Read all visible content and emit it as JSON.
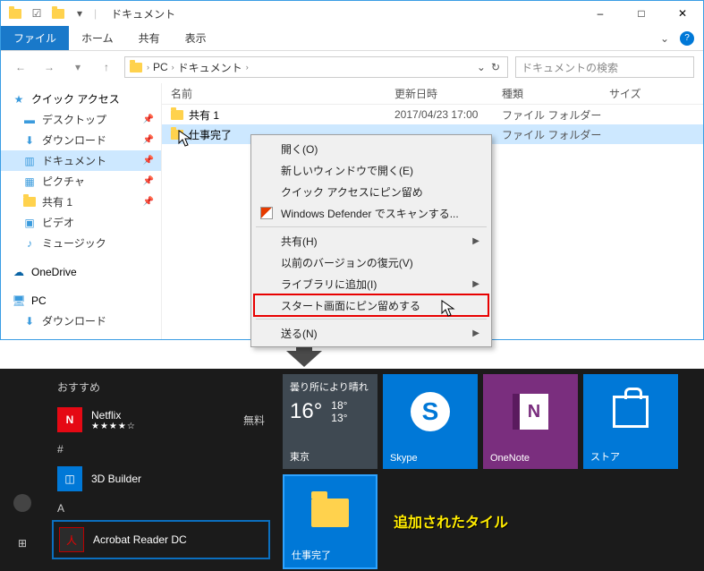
{
  "window": {
    "title": "ドキュメント",
    "controls": {
      "minimize": "–",
      "maximize": "□",
      "close": "✕"
    }
  },
  "ribbon": {
    "file": "ファイル",
    "home": "ホーム",
    "share": "共有",
    "view": "表示",
    "expand": "⌄"
  },
  "address": {
    "pc": "PC",
    "folder": "ドキュメント",
    "refresh": "↻"
  },
  "search": {
    "placeholder": "ドキュメントの検索"
  },
  "nav": {
    "quick_access": "クイック アクセス",
    "desktop": "デスクトップ",
    "downloads": "ダウンロード",
    "documents": "ドキュメント",
    "pictures": "ピクチャ",
    "share1": "共有 1",
    "videos": "ビデオ",
    "music": "ミュージック",
    "onedrive": "OneDrive",
    "pc": "PC",
    "downloads2": "ダウンロード"
  },
  "columns": {
    "name": "名前",
    "date": "更新日時",
    "type": "種類",
    "size": "サイズ"
  },
  "rows": [
    {
      "name": "共有 1",
      "date": "2017/04/23 17:00",
      "type": "ファイル フォルダー"
    },
    {
      "name": "仕事完了",
      "date": "",
      "type": "ファイル フォルダー"
    }
  ],
  "context_menu": {
    "open": "開く(O)",
    "open_new_window": "新しいウィンドウで開く(E)",
    "pin_quick_access": "クイック アクセスにピン留め",
    "defender": "Windows Defender でスキャンする...",
    "share": "共有(H)",
    "restore_versions": "以前のバージョンの復元(V)",
    "add_library": "ライブラリに追加(I)",
    "pin_start": "スタート画面にピン留めする",
    "send_to": "送る(N)"
  },
  "start": {
    "suggested": "おすすめ",
    "netflix": {
      "name": "Netflix",
      "stars": "★★★★☆",
      "price": "無料"
    },
    "letter_hash": "#",
    "builder": "3D Builder",
    "letter_a": "A",
    "acrobat": "Acrobat Reader DC",
    "weather": {
      "condition": "曇り所により晴れ",
      "temp": "16°",
      "high": "18°",
      "low": "13°",
      "city": "東京"
    },
    "skype": "Skype",
    "onenote": "OneNote",
    "store": "ストア",
    "folder_tile": "仕事完了",
    "annotation": "追加されたタイル"
  }
}
